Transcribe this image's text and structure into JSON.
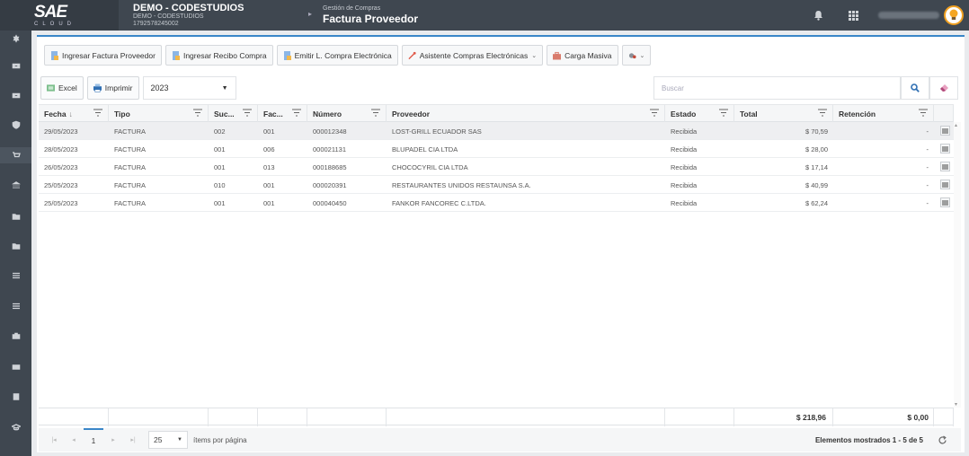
{
  "brand": {
    "logo": "SAE",
    "logo_sub": "CLOUD"
  },
  "company": {
    "name": "DEMO - CODESTUDIOS",
    "line1": "DEMO - CODESTUDIOS",
    "line2": "1792578245002"
  },
  "module": {
    "section": "Gestión de Compras",
    "title": "Factura Proveedor"
  },
  "icons": {
    "bell": "bell-icon",
    "apps": "grid-icon",
    "avatar": "lightbulb-avatar-icon",
    "rail": [
      "gear-icon",
      "inbox-icon",
      "inbox-icon",
      "shield-icon",
      "cart-icon",
      "bank-icon",
      "folder-icon",
      "folder-icon",
      "list-icon",
      "list-icon",
      "briefcase-icon",
      "card-icon",
      "book-icon",
      "graduation-icon"
    ]
  },
  "toolbar": {
    "ingresar_factura": "Ingresar Factura Proveedor",
    "ingresar_recibo": "Ingresar Recibo Compra",
    "emitir": "Emitir L. Compra Electrónica",
    "asistente": "Asistente Compras Electrónicas",
    "carga": "Carga Masiva"
  },
  "actions": {
    "excel": "Excel",
    "imprimir": "Imprimir",
    "year": "2023",
    "search_placeholder": "Buscar"
  },
  "columns": {
    "fecha": "Fecha",
    "sort_arrow": "↓",
    "tipo": "Tipo",
    "suc": "Suc...",
    "fac": "Fac...",
    "numero": "Número",
    "proveedor": "Proveedor",
    "estado": "Estado",
    "total": "Total",
    "retencion": "Retención"
  },
  "rows": [
    {
      "fecha": "29/05/2023",
      "tipo": "FACTURA",
      "suc": "002",
      "fac": "001",
      "numero": "000012348",
      "proveedor": "LOST-GRILL ECUADOR SAS",
      "estado": "Recibida",
      "total": "$ 70,59",
      "retencion": "-"
    },
    {
      "fecha": "28/05/2023",
      "tipo": "FACTURA",
      "suc": "001",
      "fac": "006",
      "numero": "000021131",
      "proveedor": "BLUPADEL CIA LTDA",
      "estado": "Recibida",
      "total": "$ 28,00",
      "retencion": "-"
    },
    {
      "fecha": "26/05/2023",
      "tipo": "FACTURA",
      "suc": "001",
      "fac": "013",
      "numero": "000188685",
      "proveedor": "CHOCOCYRIL CIA LTDA",
      "estado": "Recibida",
      "total": "$ 17,14",
      "retencion": "-"
    },
    {
      "fecha": "25/05/2023",
      "tipo": "FACTURA",
      "suc": "010",
      "fac": "001",
      "numero": "000020391",
      "proveedor": "RESTAURANTES UNIDOS RESTAUNSA S.A.",
      "estado": "Recibida",
      "total": "$ 40,99",
      "retencion": "-"
    },
    {
      "fecha": "25/05/2023",
      "tipo": "FACTURA",
      "suc": "001",
      "fac": "001",
      "numero": "000040450",
      "proveedor": "FANKOR FANCOREC C.LTDA.",
      "estado": "Recibida",
      "total": "$ 62,24",
      "retencion": "-"
    }
  ],
  "totals": {
    "total": "$ 218,96",
    "retencion": "$ 0,00"
  },
  "pager": {
    "first": "|◂",
    "prev": "◂",
    "current": "1",
    "next": "▸",
    "last": "▸|",
    "page_size": "25",
    "per_page_label": "ítems por página",
    "shown": "Elementos mostrados 1 - 5 de 5"
  },
  "colors": {
    "topbar": "#3f4750",
    "accent": "#3a86c8",
    "panel": "#ffffff"
  }
}
